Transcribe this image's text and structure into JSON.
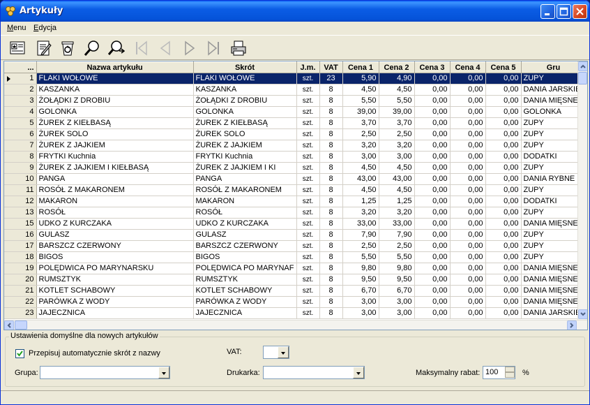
{
  "window": {
    "title": "Artykuły",
    "accent": "#0a246a"
  },
  "menu": [
    {
      "label": "Menu",
      "underline": "M"
    },
    {
      "label": "Edycja",
      "underline": "E"
    }
  ],
  "toolbar": {
    "icons": [
      "card-icon",
      "edit-icon",
      "delete-icon",
      "search-icon",
      "search-next-icon",
      "first-icon",
      "prev-icon",
      "next-icon",
      "last-icon",
      "print-icon"
    ]
  },
  "grid": {
    "columns": [
      "...",
      "Nazwa artykułu",
      "Skrót",
      "J.m.",
      "VAT",
      "Cena 1",
      "Cena 2",
      "Cena 3",
      "Cena 4",
      "Cena 5",
      "Gru"
    ],
    "rows": [
      [
        "1",
        "FLAKI WOŁOWE",
        "FLAKI WOŁOWE",
        "szt.",
        "23",
        "5,90",
        "4,90",
        "0,00",
        "0,00",
        "0,00",
        "ZUPY"
      ],
      [
        "2",
        "KASZANKA",
        "KASZANKA",
        "szt.",
        "8",
        "4,50",
        "4,50",
        "0,00",
        "0,00",
        "0,00",
        "DANIA JARSKIE"
      ],
      [
        "3",
        "ŻOŁĄDKI Z DROBIU",
        "ŻOŁĄDKI Z DROBIU",
        "szt.",
        "8",
        "5,50",
        "5,50",
        "0,00",
        "0,00",
        "0,00",
        "DANIA MIĘSNE"
      ],
      [
        "4",
        "GOLONKA",
        "GOLONKA",
        "szt.",
        "8",
        "39,00",
        "39,00",
        "0,00",
        "0,00",
        "0,00",
        "GOLONKA"
      ],
      [
        "5",
        "ŻUREK Z KIEŁBASĄ",
        "ŻUREK Z KIEŁBASĄ",
        "szt.",
        "8",
        "3,70",
        "3,70",
        "0,00",
        "0,00",
        "0,00",
        "ZUPY"
      ],
      [
        "6",
        "ŻUREK SOLO",
        "ŻUREK SOLO",
        "szt.",
        "8",
        "2,50",
        "2,50",
        "0,00",
        "0,00",
        "0,00",
        "ZUPY"
      ],
      [
        "7",
        "ŻUREK Z JAJKIEM",
        "ŻUREK Z JAJKIEM",
        "szt.",
        "8",
        "3,20",
        "3,20",
        "0,00",
        "0,00",
        "0,00",
        "ZUPY"
      ],
      [
        "8",
        "FRYTKI Kuchnia",
        "FRYTKI Kuchnia",
        "szt.",
        "8",
        "3,00",
        "3,00",
        "0,00",
        "0,00",
        "0,00",
        "DODATKI"
      ],
      [
        "9",
        "ŻUREK Z JAJKIEM I KIEŁBASĄ",
        "ŻUREK Z JAJKIEM I KI",
        "szt.",
        "8",
        "4,50",
        "4,50",
        "0,00",
        "0,00",
        "0,00",
        "ZUPY"
      ],
      [
        "10",
        "PANGA",
        "PANGA",
        "szt.",
        "8",
        "43,00",
        "43,00",
        "0,00",
        "0,00",
        "0,00",
        "DANIA RYBNE"
      ],
      [
        "11",
        "ROSÓŁ Z MAKARONEM",
        "ROSÓŁ Z MAKARONEM",
        "szt.",
        "8",
        "4,50",
        "4,50",
        "0,00",
        "0,00",
        "0,00",
        "ZUPY"
      ],
      [
        "12",
        "MAKARON",
        "MAKARON",
        "szt.",
        "8",
        "1,25",
        "1,25",
        "0,00",
        "0,00",
        "0,00",
        "DODATKI"
      ],
      [
        "13",
        "ROSÓŁ",
        "ROSÓŁ",
        "szt.",
        "8",
        "3,20",
        "3,20",
        "0,00",
        "0,00",
        "0,00",
        "ZUPY"
      ],
      [
        "15",
        "UDKO Z KURCZAKA",
        "UDKO Z KURCZAKA",
        "szt.",
        "8",
        "33,00",
        "33,00",
        "0,00",
        "0,00",
        "0,00",
        "DANIA MIĘSNE"
      ],
      [
        "16",
        "GULASZ",
        "GULASZ",
        "szt.",
        "8",
        "7,90",
        "7,90",
        "0,00",
        "0,00",
        "0,00",
        "ZUPY"
      ],
      [
        "17",
        "BARSZCZ CZERWONY",
        "BARSZCZ CZERWONY",
        "szt.",
        "8",
        "2,50",
        "2,50",
        "0,00",
        "0,00",
        "0,00",
        "ZUPY"
      ],
      [
        "18",
        "BIGOS",
        "BIGOS",
        "szt.",
        "8",
        "5,50",
        "5,50",
        "0,00",
        "0,00",
        "0,00",
        "ZUPY"
      ],
      [
        "19",
        "POLĘDWICA PO MARYNARSKU",
        "POLĘDWICA PO MARYNAF",
        "szt.",
        "8",
        "9,80",
        "9,80",
        "0,00",
        "0,00",
        "0,00",
        "DANIA MIĘSNE"
      ],
      [
        "20",
        "RUMSZTYK",
        "RUMSZTYK",
        "szt.",
        "8",
        "9,50",
        "9,50",
        "0,00",
        "0,00",
        "0,00",
        "DANIA MIĘSNE"
      ],
      [
        "21",
        "KOTLET SCHABOWY",
        "KOTLET SCHABOWY",
        "szt.",
        "8",
        "6,70",
        "6,70",
        "0,00",
        "0,00",
        "0,00",
        "DANIA MIĘSNE"
      ],
      [
        "22",
        "PARÓWKA Z WODY",
        "PARÓWKA Z WODY",
        "szt.",
        "8",
        "3,00",
        "3,00",
        "0,00",
        "0,00",
        "0,00",
        "DANIA MIĘSNE"
      ],
      [
        "23",
        "JAJECZNICA",
        "JAJECZNICA",
        "szt.",
        "8",
        "3,00",
        "3,00",
        "0,00",
        "0,00",
        "0,00",
        "DANIA JARSKIE"
      ]
    ],
    "selected_row": 0
  },
  "defaults": {
    "title": "Ustawienia domyślne dla nowych artykułów",
    "auto_abbrev_label": "Przepisuj automatycznie skrót z nazwy",
    "auto_abbrev_checked": true,
    "vat_label": "VAT:",
    "vat_value": "",
    "group_label": "Grupa:",
    "group_value": "",
    "printer_label": "Drukarka:",
    "printer_value": "",
    "max_discount_label": "Maksymalny rabat:",
    "max_discount_value": "100",
    "percent_sign": "%"
  }
}
